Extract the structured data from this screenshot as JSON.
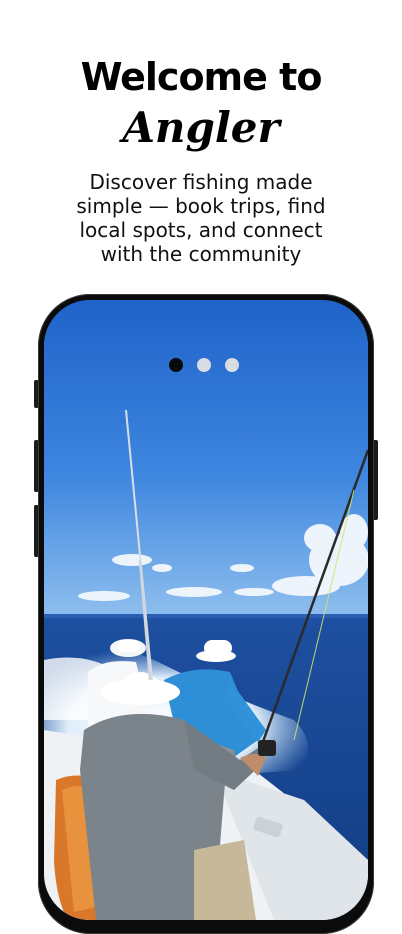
{
  "welcome": {
    "title_line1": "Welcome to",
    "title_line2": "Angler",
    "subtitle": "Discover fishing made simple — book trips, find local spots, and connect with the community"
  },
  "carousel": {
    "slide_count": 3,
    "active_index": 0,
    "active_color": "#0a0a0a",
    "inactive_color": "#d8dde4"
  },
  "hero_image": {
    "depicts": "fishing-boat-offshore"
  },
  "colors": {
    "background": "#ffffff",
    "text": "#000000",
    "phone_frame": "#0b0b0b"
  }
}
